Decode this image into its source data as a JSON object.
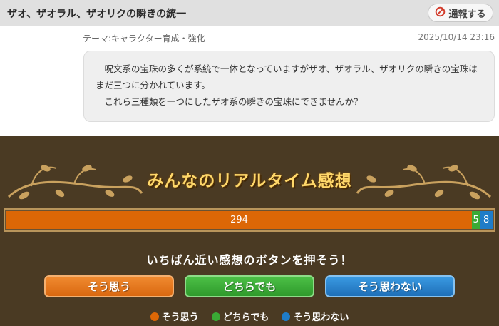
{
  "header": {
    "title": "ザオ、ザオラル、ザオリクの瞬きの統一",
    "report_label": "通報する"
  },
  "post": {
    "theme": "テーマ:キャラクター育成・強化",
    "date": "2025/10/14 23:16",
    "body": [
      "呪文系の宝珠の多くが系統で一体となっていますがザオ、ザオラル、ザオリクの瞬きの宝珠はまだ三つに分かれています。",
      "これら三種類を一つにしたザオ系の瞬きの宝珠にできませんか？"
    ]
  },
  "realtime": {
    "title": "みんなのリアルタイム感想",
    "counts": {
      "agree": 294,
      "neutral": 5,
      "disagree": 8
    },
    "count_labels": {
      "agree": "294",
      "neutral": "5",
      "disagree": "8"
    },
    "prompt": "いちばん近い感想のボタンを押そう！",
    "buttons": {
      "agree": "そう思う",
      "neutral": "どちらでも",
      "disagree": "そう思わない"
    },
    "legend": {
      "agree": "そう思う",
      "neutral": "どちらでも",
      "disagree": "そう思わない"
    },
    "colors": {
      "agree": "#dc6706",
      "neutral": "#3aaa35",
      "disagree": "#1f7cc8",
      "title": "#ffd86a",
      "panel": "#4a3a23"
    }
  }
}
